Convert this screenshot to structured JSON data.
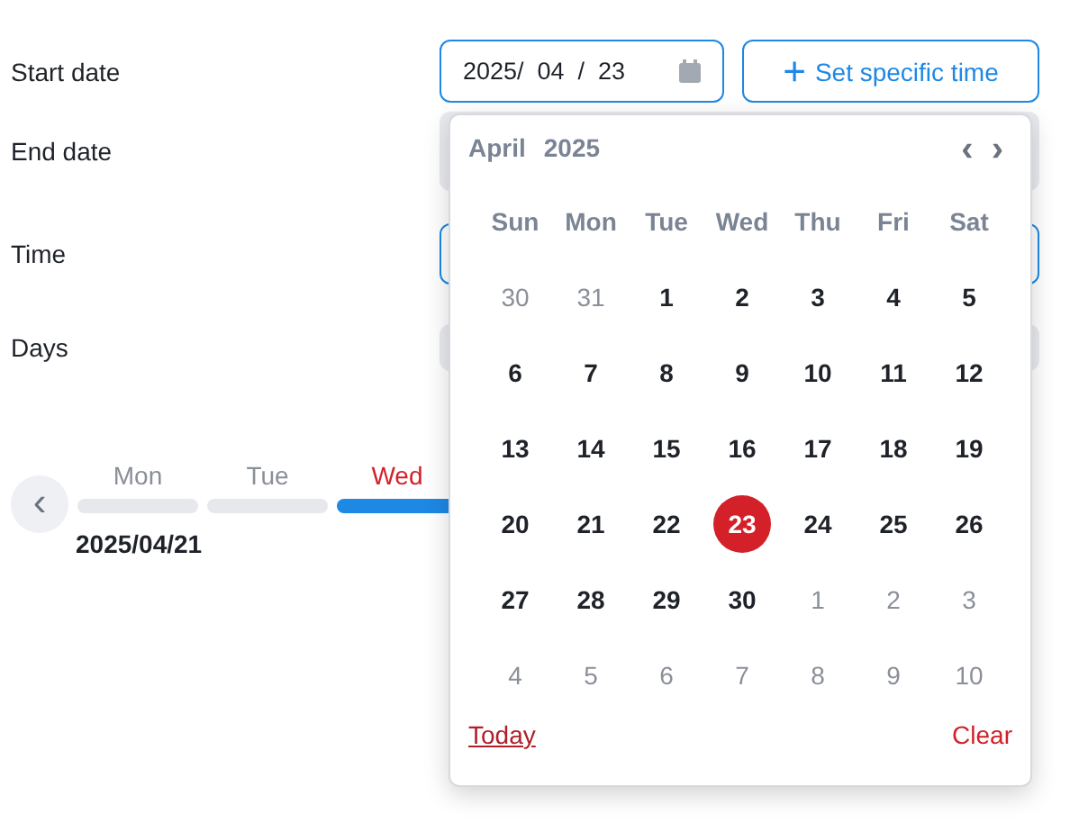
{
  "form": [
    {
      "label": "Start date",
      "kind": "date",
      "value": "2025/  04  /  23"
    },
    {
      "label": "End date",
      "kind": "blank",
      "focused": false
    },
    {
      "label": "Time",
      "kind": "blank",
      "focused": true
    },
    {
      "label": "Days",
      "kind": "blank",
      "focused": false
    }
  ],
  "time_button": {
    "icon": "+",
    "label": "Set specific time"
  },
  "week_strip": {
    "back": "‹",
    "days": [
      {
        "label": "Mon",
        "selected": false
      },
      {
        "label": "Tue",
        "selected": false
      },
      {
        "label": "Wed",
        "selected": true
      }
    ],
    "date": "2025/04/21"
  },
  "calendar": {
    "month": "April",
    "year": "2025",
    "prev": "‹",
    "next": "›",
    "weekdays": [
      "Sun",
      "Mon",
      "Tue",
      "Wed",
      "Thu",
      "Fri",
      "Sat"
    ],
    "weeks": [
      [
        {
          "label": "30",
          "outside": true,
          "selected": false
        },
        {
          "label": "31",
          "outside": true,
          "selected": false
        },
        {
          "label": "1",
          "outside": false,
          "selected": false
        },
        {
          "label": "2",
          "outside": false,
          "selected": false
        },
        {
          "label": "3",
          "outside": false,
          "selected": false
        },
        {
          "label": "4",
          "outside": false,
          "selected": false
        },
        {
          "label": "5",
          "outside": false,
          "selected": false
        }
      ],
      [
        {
          "label": "6",
          "outside": false,
          "selected": false
        },
        {
          "label": "7",
          "outside": false,
          "selected": false
        },
        {
          "label": "8",
          "outside": false,
          "selected": false
        },
        {
          "label": "9",
          "outside": false,
          "selected": false
        },
        {
          "label": "10",
          "outside": false,
          "selected": false
        },
        {
          "label": "11",
          "outside": false,
          "selected": false
        },
        {
          "label": "12",
          "outside": false,
          "selected": false
        }
      ],
      [
        {
          "label": "13",
          "outside": false,
          "selected": false
        },
        {
          "label": "14",
          "outside": false,
          "selected": false
        },
        {
          "label": "15",
          "outside": false,
          "selected": false
        },
        {
          "label": "16",
          "outside": false,
          "selected": false
        },
        {
          "label": "17",
          "outside": false,
          "selected": false
        },
        {
          "label": "18",
          "outside": false,
          "selected": false
        },
        {
          "label": "19",
          "outside": false,
          "selected": false
        }
      ],
      [
        {
          "label": "20",
          "outside": false,
          "selected": false
        },
        {
          "label": "21",
          "outside": false,
          "selected": false
        },
        {
          "label": "22",
          "outside": false,
          "selected": false
        },
        {
          "label": "23",
          "outside": false,
          "selected": true
        },
        {
          "label": "24",
          "outside": false,
          "selected": false
        },
        {
          "label": "25",
          "outside": false,
          "selected": false
        },
        {
          "label": "26",
          "outside": false,
          "selected": false
        }
      ],
      [
        {
          "label": "27",
          "outside": false,
          "selected": false
        },
        {
          "label": "28",
          "outside": false,
          "selected": false
        },
        {
          "label": "29",
          "outside": false,
          "selected": false
        },
        {
          "label": "30",
          "outside": false,
          "selected": false
        },
        {
          "label": "1",
          "outside": true,
          "selected": false
        },
        {
          "label": "2",
          "outside": true,
          "selected": false
        },
        {
          "label": "3",
          "outside": true,
          "selected": false
        }
      ],
      [
        {
          "label": "4",
          "outside": true,
          "selected": false
        },
        {
          "label": "5",
          "outside": true,
          "selected": false
        },
        {
          "label": "6",
          "outside": true,
          "selected": false
        },
        {
          "label": "7",
          "outside": true,
          "selected": false
        },
        {
          "label": "8",
          "outside": true,
          "selected": false
        },
        {
          "label": "9",
          "outside": true,
          "selected": false
        },
        {
          "label": "10",
          "outside": true,
          "selected": false
        }
      ]
    ],
    "today": "Today",
    "clear": "Clear"
  }
}
